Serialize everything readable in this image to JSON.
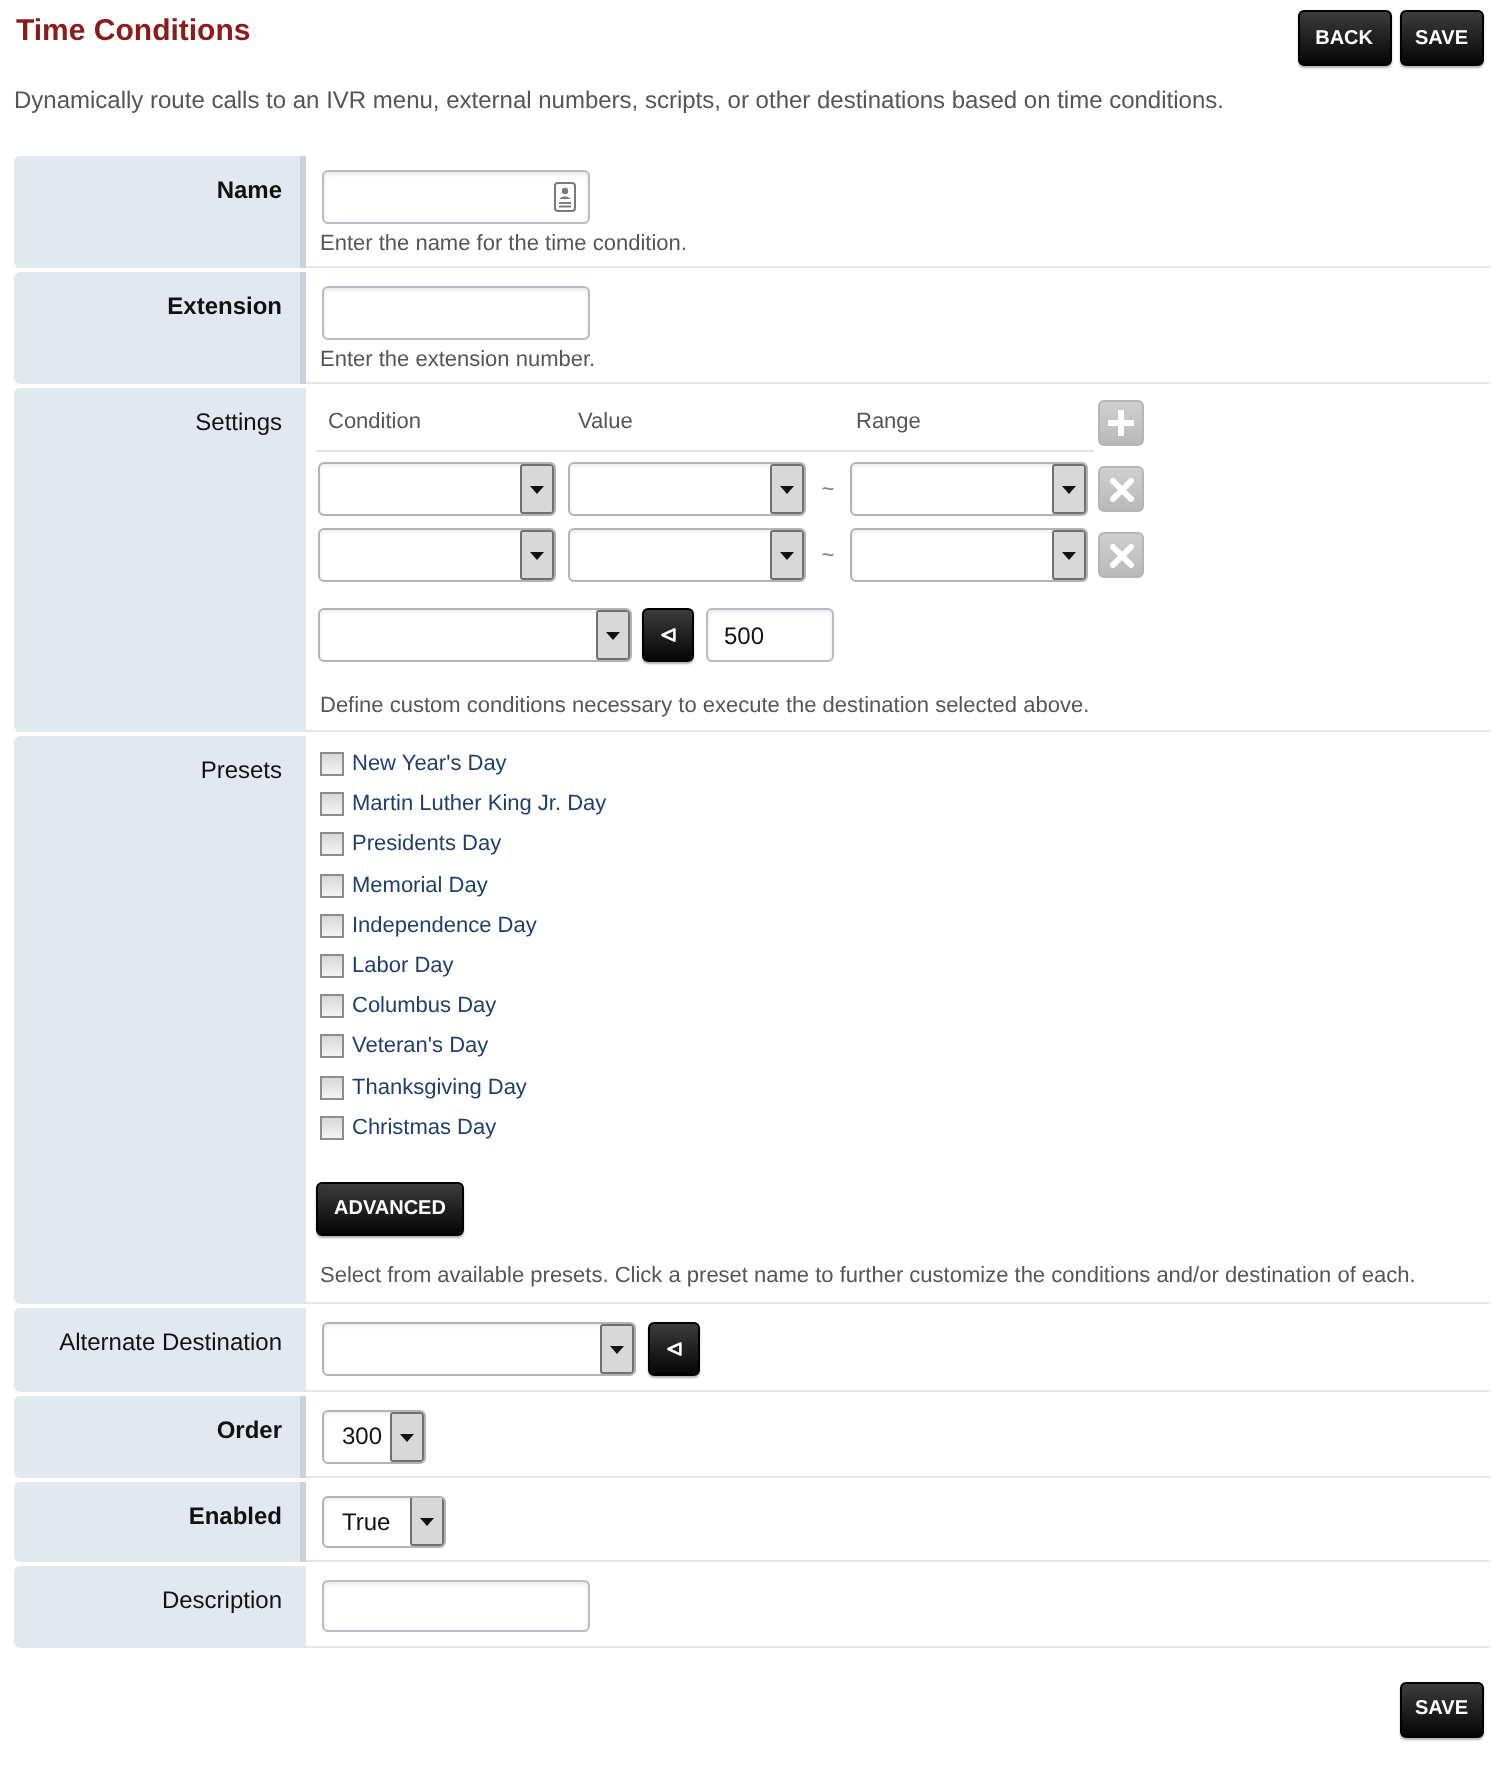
{
  "header": {
    "title": "Time Conditions",
    "buttons": [
      "BACK",
      "SAVE"
    ]
  },
  "description": "Dynamically route calls to an IVR menu, external numbers, scripts, or other destinations based on time conditions.",
  "form": [
    {
      "kind": "text",
      "label": "Name",
      "required": true,
      "contact_icon": true,
      "hint": "Enter the name for the time condition."
    },
    {
      "kind": "text",
      "label": "Extension",
      "required": true,
      "contact_icon": false,
      "hint": "Enter the extension number."
    },
    {
      "kind": "settings",
      "label": "Settings",
      "required": false,
      "columns": [
        "Condition",
        "Value",
        "Range"
      ],
      "conditions": [
        {
          "separator": "~"
        },
        {
          "separator": "~"
        }
      ],
      "destination_value": "500",
      "hint": "Define custom conditions necessary to execute the destination selected above."
    },
    {
      "kind": "presets",
      "label": "Presets",
      "required": false,
      "presets": [
        {
          "label": "New Year's Day",
          "checked": false
        },
        {
          "label": "Martin Luther King Jr. Day",
          "checked": false
        },
        {
          "label": "Presidents Day",
          "checked": false
        },
        {
          "label": "Memorial Day",
          "checked": false
        },
        {
          "label": "Independence Day",
          "checked": false
        },
        {
          "label": "Labor Day",
          "checked": false
        },
        {
          "label": "Columbus Day",
          "checked": false
        },
        {
          "label": "Veteran's Day",
          "checked": false
        },
        {
          "label": "Thanksgiving Day",
          "checked": false
        },
        {
          "label": "Christmas Day",
          "checked": false
        }
      ],
      "button": "ADVANCED",
      "hint": "Select from available presets. Click a preset name to further customize the conditions and/or destination of each."
    },
    {
      "kind": "destination",
      "label": "Alternate Destination",
      "required": false
    },
    {
      "kind": "select",
      "label": "Order",
      "required": true,
      "value": "300"
    },
    {
      "kind": "select",
      "label": "Enabled",
      "required": true,
      "value": "True"
    },
    {
      "kind": "text",
      "label": "Description",
      "required": false,
      "contact_icon": false
    }
  ],
  "footer": {
    "buttons": [
      "SAVE"
    ]
  }
}
